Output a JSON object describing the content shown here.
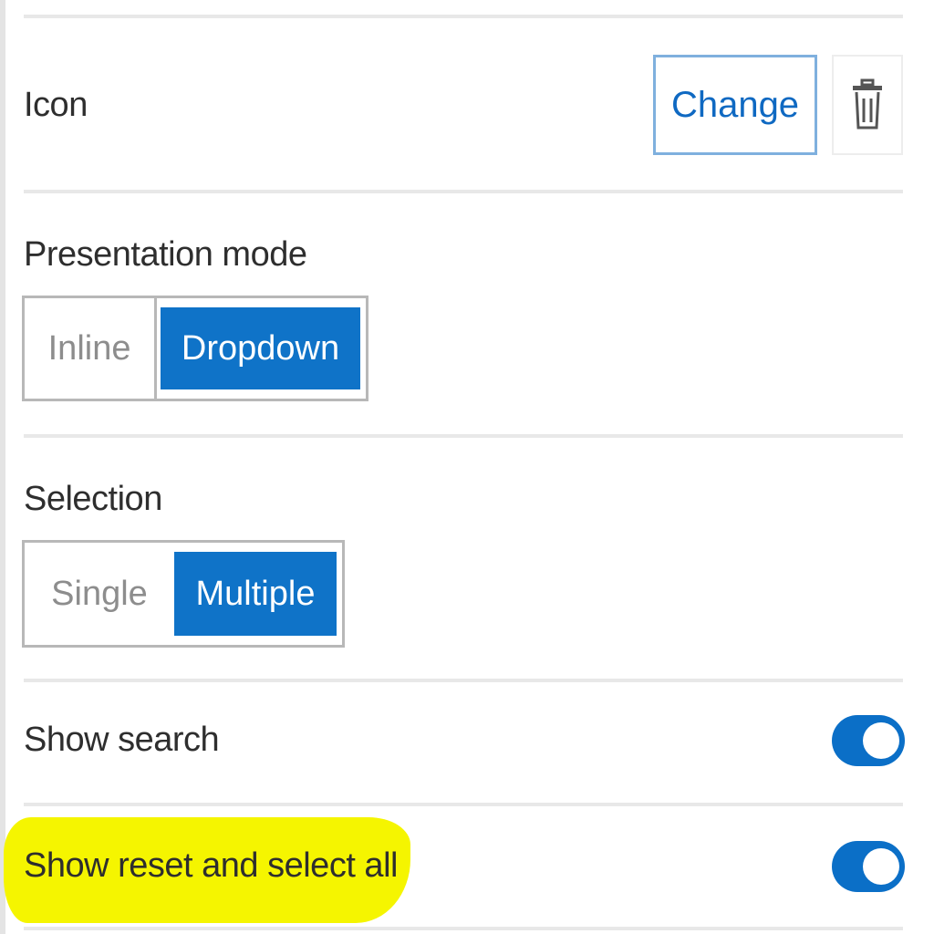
{
  "icon_row": {
    "label": "Icon",
    "change_label": "Change",
    "delete_icon": "trash-icon"
  },
  "presentation_mode": {
    "label": "Presentation mode",
    "options": [
      "Inline",
      "Dropdown"
    ],
    "selected": "Dropdown"
  },
  "selection": {
    "label": "Selection",
    "options": [
      "Single",
      "Multiple"
    ],
    "selected": "Multiple"
  },
  "show_search": {
    "label": "Show search",
    "enabled": true
  },
  "show_reset_select_all": {
    "label": "Show reset and select all",
    "enabled": true,
    "highlighted": true
  },
  "colors": {
    "accent": "#0f73c8",
    "toggle_on": "#0b6fc7",
    "change_border": "#7fb0de",
    "highlight": "#f5f500"
  }
}
